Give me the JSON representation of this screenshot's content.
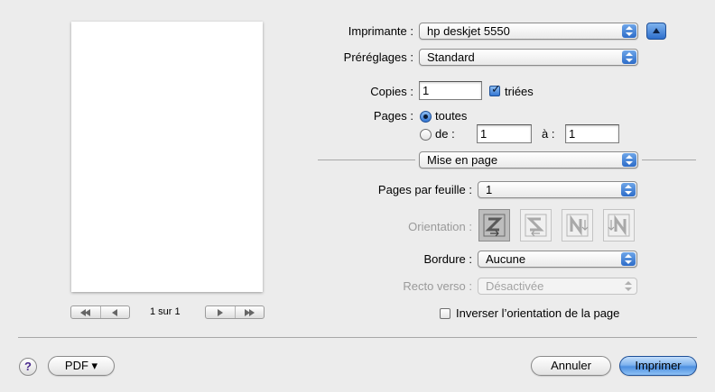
{
  "preview": {
    "page_counter": "1 sur 1"
  },
  "printer": {
    "label": "Imprimante :",
    "value": "hp deskjet 5550"
  },
  "presets": {
    "label": "Préréglages :",
    "value": "Standard"
  },
  "copies": {
    "label": "Copies :",
    "value": "1",
    "collated_label": "triées",
    "collated_checked": true
  },
  "pages": {
    "label": "Pages :",
    "all_label": "toutes",
    "from_label": "de :",
    "from_value": "1",
    "to_label": "à :",
    "to_value": "1",
    "selected": "all"
  },
  "section_popup": {
    "value": "Mise en page"
  },
  "layout": {
    "pages_per_sheet_label": "Pages par feuille :",
    "pages_per_sheet_value": "1",
    "orientation_label": "Orientation :",
    "orientation_options": [
      "z-icon",
      "s-icon",
      "n-down-icon",
      "n-up-icon"
    ],
    "orientation_selected": 0,
    "border_label": "Bordure :",
    "border_value": "Aucune",
    "duplex_label": "Recto verso :",
    "duplex_value": "Désactivée",
    "reverse_label": "Inverser l’orientation de la page",
    "reverse_checked": false
  },
  "footer": {
    "help": "?",
    "pdf_label": "PDF ▾",
    "cancel_label": "Annuler",
    "print_label": "Imprimer"
  }
}
